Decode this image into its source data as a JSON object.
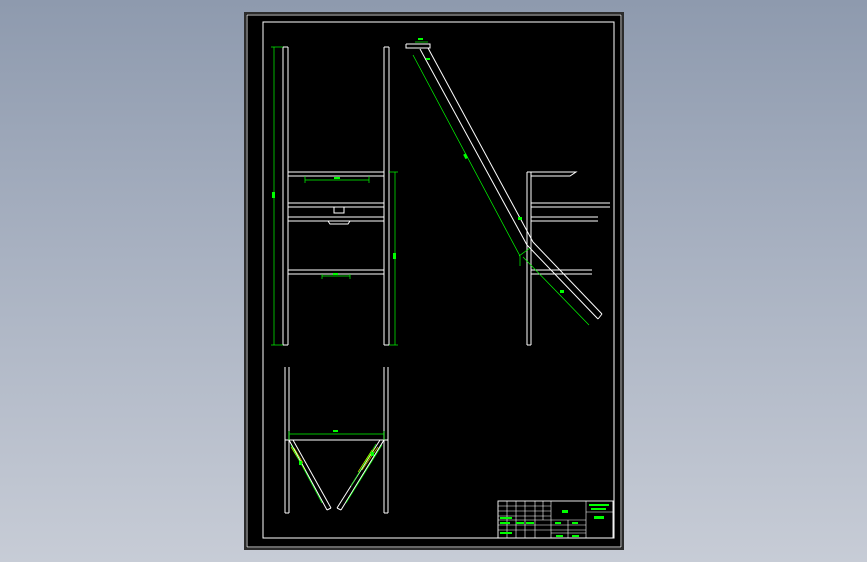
{
  "viewer": {
    "background_top": "#8e9aae",
    "background_bottom": "#c7ccd6",
    "sheet_color": "#000000",
    "frame_color": "#ffffff",
    "geometry_color": "#ffffff",
    "dimension_color": "#00ff00",
    "hatch_color": "#ffff00"
  },
  "drawing": {
    "orientation": "portrait",
    "views": [
      "front-view",
      "side-view",
      "bottom-view"
    ]
  }
}
